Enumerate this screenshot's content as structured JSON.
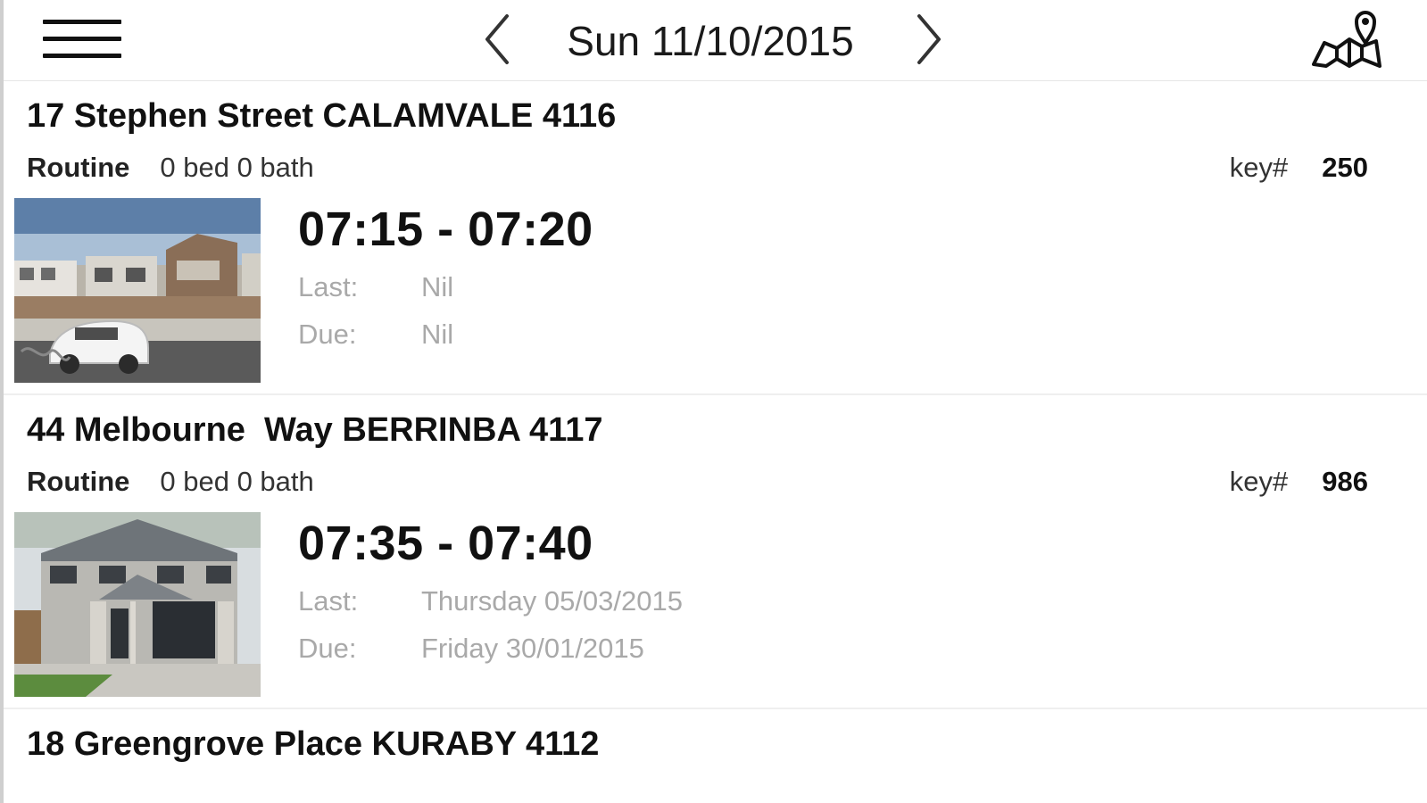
{
  "header": {
    "date": "Sun 11/10/2015",
    "menu_icon": "hamburger-menu-icon",
    "prev_icon": "chevron-left-icon",
    "next_icon": "chevron-right-icon",
    "map_icon": "map-pin-icon"
  },
  "labels": {
    "last": "Last:",
    "due": "Due:",
    "key": "key#"
  },
  "inspections": [
    {
      "address": "17 Stephen Street CALAMVALE 4116",
      "type": "Routine",
      "rooms": "0 bed 0 bath",
      "key_number": "250",
      "time": "07:15 - 07:20",
      "last": "Nil",
      "due": "Nil"
    },
    {
      "address": "44 Melbourne  Way BERRINBA 4117",
      "type": "Routine",
      "rooms": "0 bed 0 bath",
      "key_number": "986",
      "time": "07:35 - 07:40",
      "last": "Thursday 05/03/2015",
      "due": "Friday 30/01/2015"
    },
    {
      "address": "18 Greengrove Place KURABY 4112"
    }
  ]
}
